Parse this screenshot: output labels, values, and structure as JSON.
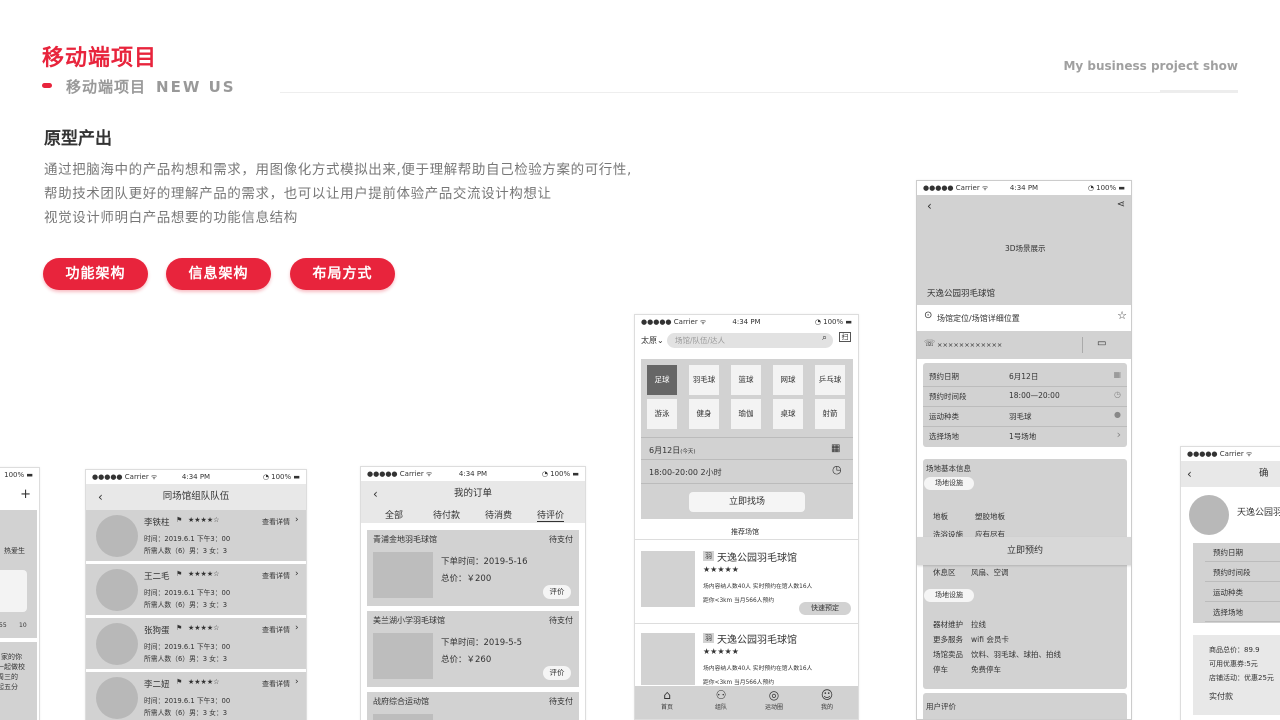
{
  "header": {
    "title": "移动端项目",
    "subtitle_cn": "移动端项目",
    "subtitle_en": "NEW US",
    "right_text": "My business project show"
  },
  "section": {
    "title": "原型产出",
    "lines": [
      "通过把脑海中的产品构想和需求，用图像化方式模拟出来,便于理解帮助自己检验方案的可行性,",
      "帮助技术团队更好的理解产品的需求，也可以让用户提前体验产品交流设计构想让",
      "视觉设计师明白产品想要的功能信息结构"
    ],
    "pills": [
      "功能架构",
      "信息架构",
      "布局方式"
    ]
  },
  "colors": {
    "accent": "#e8243c",
    "placeholder": "#d2d2d2"
  },
  "status": {
    "carrier": "●●●●● Carrier ᯤ",
    "time": "4:34 PM",
    "battery": "◔ 100% ▬"
  },
  "phone0": {
    "plus": "+",
    "frag1": "，热爱生",
    "frag2": "55",
    "frag3": "10",
    "frag4": "家的你",
    "frag5": "一起做校",
    "frag6": "周三的",
    "frag7": "起五分",
    "battery": "100% ▬"
  },
  "team": {
    "title": "同场馆组队队伍",
    "view": "查看详情",
    "rows": [
      {
        "name": "李铁柱",
        "stars": "★★★★☆",
        "time": "时间：2019.6.1  下午3：00",
        "need": "所需人数（6）男：3 女：3"
      },
      {
        "name": "王二毛",
        "stars": "★★★★☆",
        "time": "时间：2019.6.1  下午3：00",
        "need": "所需人数（6）男：3 女：3"
      },
      {
        "name": "张狗蛋",
        "stars": "★★★★☆",
        "time": "时间：2019.6.1  下午3：00",
        "need": "所需人数（6）男：3 女：3"
      },
      {
        "name": "李二妞",
        "stars": "★★★★☆",
        "time": "时间：2019.6.1  下午3：00",
        "need": "所需人数（6）男：3 女：3"
      }
    ]
  },
  "orders": {
    "title": "我的订单",
    "tabs": [
      "全部",
      "待付款",
      "待消费",
      "待评价"
    ],
    "items": [
      {
        "venue": "青浦金地羽毛球馆",
        "status": "待支付",
        "time": "下单时间：2019-5-16",
        "total": "总价：￥200",
        "btn": "评价"
      },
      {
        "venue": "美兰湖小学羽毛球馆",
        "status": "待支付",
        "time": "下单时间：2019-5-5",
        "total": "总价：￥260",
        "btn": "评价"
      },
      {
        "venue": "战府综合运动馆",
        "status": "待支付"
      }
    ]
  },
  "home": {
    "city": "太原",
    "search_placeholder": "场馆/队伍/达人",
    "scan": "扫",
    "sports": [
      "足球",
      "羽毛球",
      "篮球",
      "网球",
      "乒乓球",
      "游泳",
      "健身",
      "瑜伽",
      "桌球",
      "射箭"
    ],
    "date": "6月12日",
    "date_note": "(今天)",
    "time": "18:00-20:00  2小时",
    "find_btn": "立即找场",
    "rec_title": "推荐场馆",
    "venues": [
      {
        "tag": "羽",
        "name": "天逸公园羽毛球馆",
        "stars": "★★★★★",
        "cap": "场内容纳人数40人    实时预约在馆人数16人",
        "dist": "距你<3km    当月566人预约",
        "btn": "快速预定"
      },
      {
        "tag": "羽",
        "name": "天逸公园羽毛球馆",
        "stars": "★★★★★",
        "cap": "场内容纳人数40人    实时预约在馆人数16人",
        "dist": "距你<3km    当月566人预约"
      }
    ],
    "tabbar": [
      "首页",
      "组队",
      "运动圈",
      "我的"
    ]
  },
  "detail": {
    "banner": "3D场景展示",
    "venue": "天逸公园羽毛球馆",
    "location": "场馆定位/场馆详细位置",
    "phone": "××××××××××××",
    "rows": [
      {
        "label": "预约日期",
        "value": "6月12日"
      },
      {
        "label": "预约时间段",
        "value": "18:00—20:00"
      },
      {
        "label": "运动种类",
        "value": "羽毛球"
      },
      {
        "label": "选择场地",
        "value": "1号场地"
      }
    ],
    "info_title": "场地基本信息",
    "facility_tag": "场地设施",
    "facility": [
      {
        "label": "地板",
        "value": "塑胶地板"
      },
      {
        "label": "洗浴设施",
        "value": "应有尽有"
      }
    ],
    "book_btn": "立即预约",
    "rest": {
      "label": "休息区",
      "value": "风扇、空调"
    },
    "facility_tag2": "场地设施",
    "more": [
      {
        "label": "器材维护",
        "value": "拉线"
      },
      {
        "label": "更多服务",
        "value": "wifi  会员卡"
      },
      {
        "label": "场馆卖品",
        "value": "饮料、羽毛球、球拍、拍线"
      },
      {
        "label": "停车",
        "value": "免费停车"
      }
    ],
    "review": "用户评价"
  },
  "confirm": {
    "title_frag": "确",
    "venue_frag": "天逸公园羽",
    "rows": [
      "预约日期",
      "预约时间段",
      "运动种类",
      "选择场地"
    ],
    "total": "商品总价：89.9",
    "coupon": "可用优惠券:5元",
    "promo": "店铺活动：优惠25元",
    "paid": "实付款",
    "carrier": "●●●●● Carrier ᯤ"
  }
}
